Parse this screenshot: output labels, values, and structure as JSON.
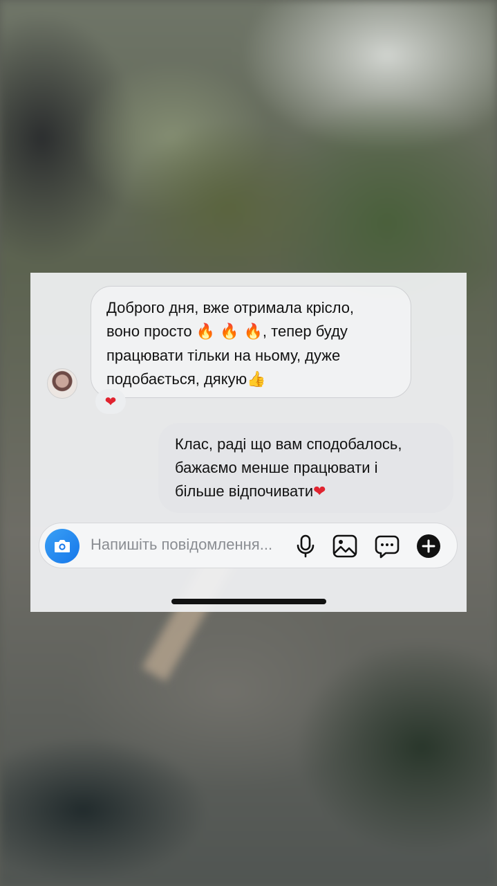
{
  "thread": {
    "incoming": {
      "line1": "Доброго дня, вже отримала крісло,",
      "line2_start": "воно просто ",
      "line2_emojis": "🔥 🔥 🔥",
      "line2_end": ", тепер буду",
      "line3": "працювати тільки на ньому, дуже",
      "line4_text": "подобається, дякую",
      "line4_emoji": "👍",
      "reaction": "❤"
    },
    "outgoing": {
      "line1": "Клас, раді що вам сподобалось,",
      "line2": "бажаємо менше працювати і",
      "line3_text": "більше відпочивати",
      "line3_emoji": "❤"
    }
  },
  "composer": {
    "placeholder": "Напишіть повідомлення..."
  },
  "icons": {
    "camera": "camera-icon",
    "mic": "microphone-icon",
    "gallery": "image-icon",
    "sticker": "chat-bubble-icon",
    "plus": "plus-icon"
  },
  "colors": {
    "camera_button": "#1677ea",
    "heart": "#e0232f"
  }
}
